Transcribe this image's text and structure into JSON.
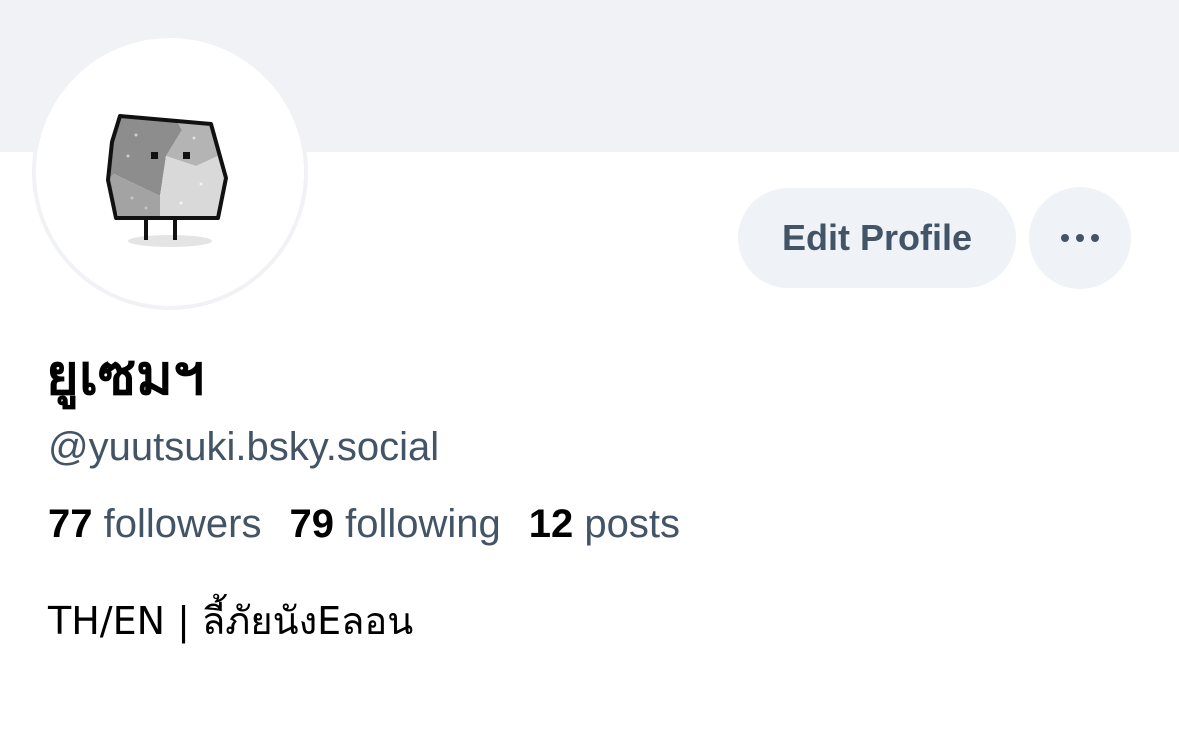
{
  "profile": {
    "display_name": "ยูเซมฯ",
    "handle": "@yuutsuki.bsky.social",
    "bio": "TH/EN | ลี้ภัยนังEลอน",
    "avatar_icon": "stone-creature-icon"
  },
  "actions": {
    "edit_label": "Edit Profile",
    "more_icon": "more-horizontal-icon"
  },
  "stats": {
    "followers_count": "77",
    "followers_label": "followers",
    "following_count": "79",
    "following_label": "following",
    "posts_count": "12",
    "posts_label": "posts"
  },
  "colors": {
    "banner": "#f1f2f5",
    "button_bg": "#eff2f6",
    "secondary_text": "#425466",
    "primary_text": "#000000"
  }
}
